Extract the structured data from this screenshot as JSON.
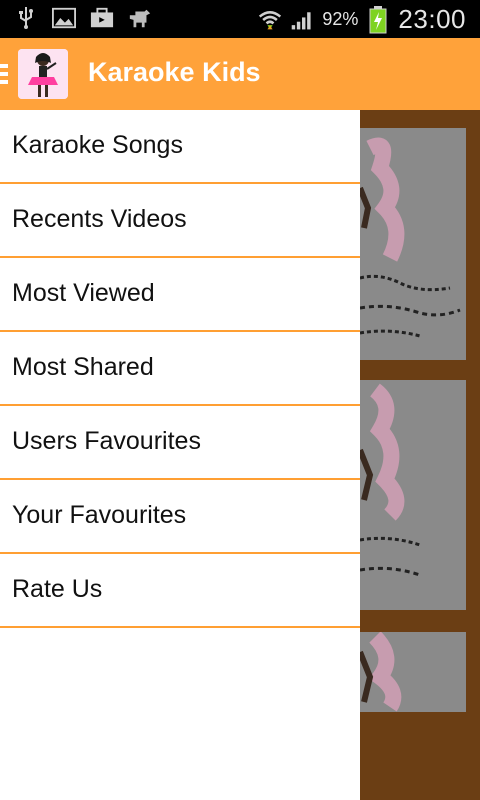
{
  "status_bar": {
    "battery_percent": "92%",
    "time": "23:00",
    "icons": [
      "usb-icon",
      "image-icon",
      "briefcase-icon",
      "android-icon",
      "wifi-icon",
      "signal-icon",
      "battery-charging-icon"
    ]
  },
  "action_bar": {
    "title": "Karaoke Kids",
    "icon": "app-logo-girl-singer",
    "accent_color": "#ffa23a"
  },
  "drawer": {
    "items": [
      {
        "label": "Karaoke Songs"
      },
      {
        "label": "Recents Videos"
      },
      {
        "label": "Most Viewed"
      },
      {
        "label": "Most Shared"
      },
      {
        "label": "Users Favourites"
      },
      {
        "label": "Your Favourites"
      },
      {
        "label": "Rate Us"
      }
    ],
    "divider_color": "#ff9f33"
  },
  "background": {
    "color": "#6b3e14",
    "cards": [
      {
        "name": "video-card-1"
      },
      {
        "name": "video-card-2"
      },
      {
        "name": "video-card-3"
      }
    ]
  }
}
